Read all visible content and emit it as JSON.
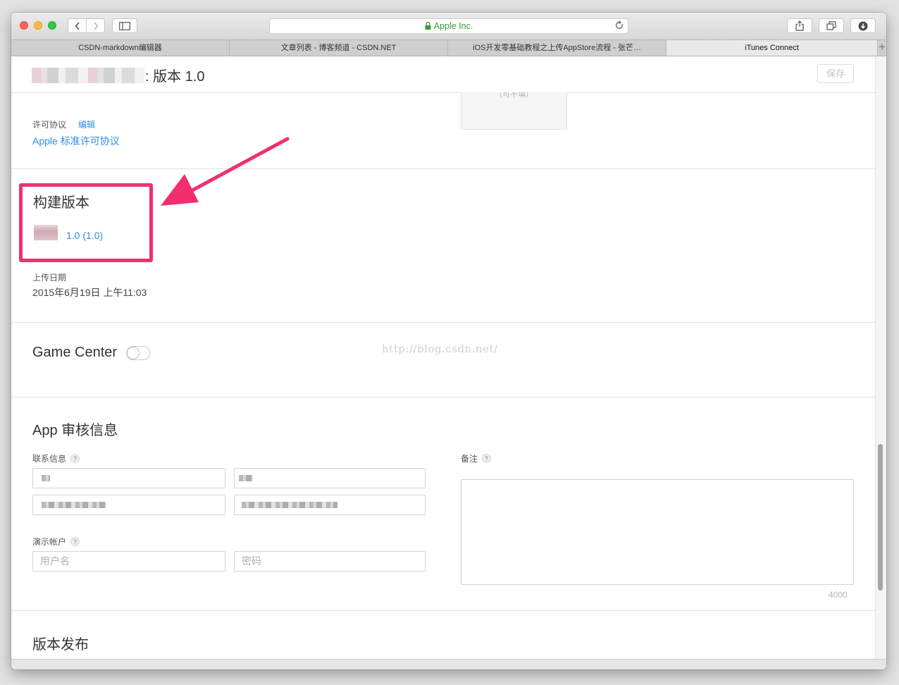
{
  "browser": {
    "address_text": "Apple Inc.",
    "tabs": [
      {
        "label": "CSDN-markdown编辑器",
        "active": false
      },
      {
        "label": "文章列表 - 博客频道 - CSDN.NET",
        "active": false
      },
      {
        "label": "iOS开发零基础教程之上传AppStore流程 - 张芒…",
        "active": false
      },
      {
        "label": "iTunes Connect",
        "active": true
      }
    ],
    "new_tab_label": "+",
    "accent_color": "#3a9b3e"
  },
  "page": {
    "title": ": 版本 1.0",
    "save_label": "保存",
    "placeholder_text": "（可不填）"
  },
  "license": {
    "label": "许可协议",
    "edit_label": "编辑",
    "link_label": "Apple 标准许可协议"
  },
  "build": {
    "title": "构建版本",
    "version_link": "1.0 (1.0)",
    "upload_label": "上传日期",
    "upload_date": "2015年6月19日 上午11:03"
  },
  "game_center": {
    "title": "Game Center",
    "enabled": false
  },
  "watermark": "http://blog.csdn.net/",
  "review": {
    "title": "App 审核信息",
    "contact_label": "联系信息",
    "demo_label": "演示帐户",
    "username_placeholder": "用户名",
    "password_placeholder": "密码",
    "notes_label": "备注",
    "notes_limit": "4000",
    "help_glyph": "?"
  },
  "release": {
    "title": "版本发布"
  },
  "colors": {
    "link": "#2d8ee8",
    "annotation": "#f0306e"
  }
}
